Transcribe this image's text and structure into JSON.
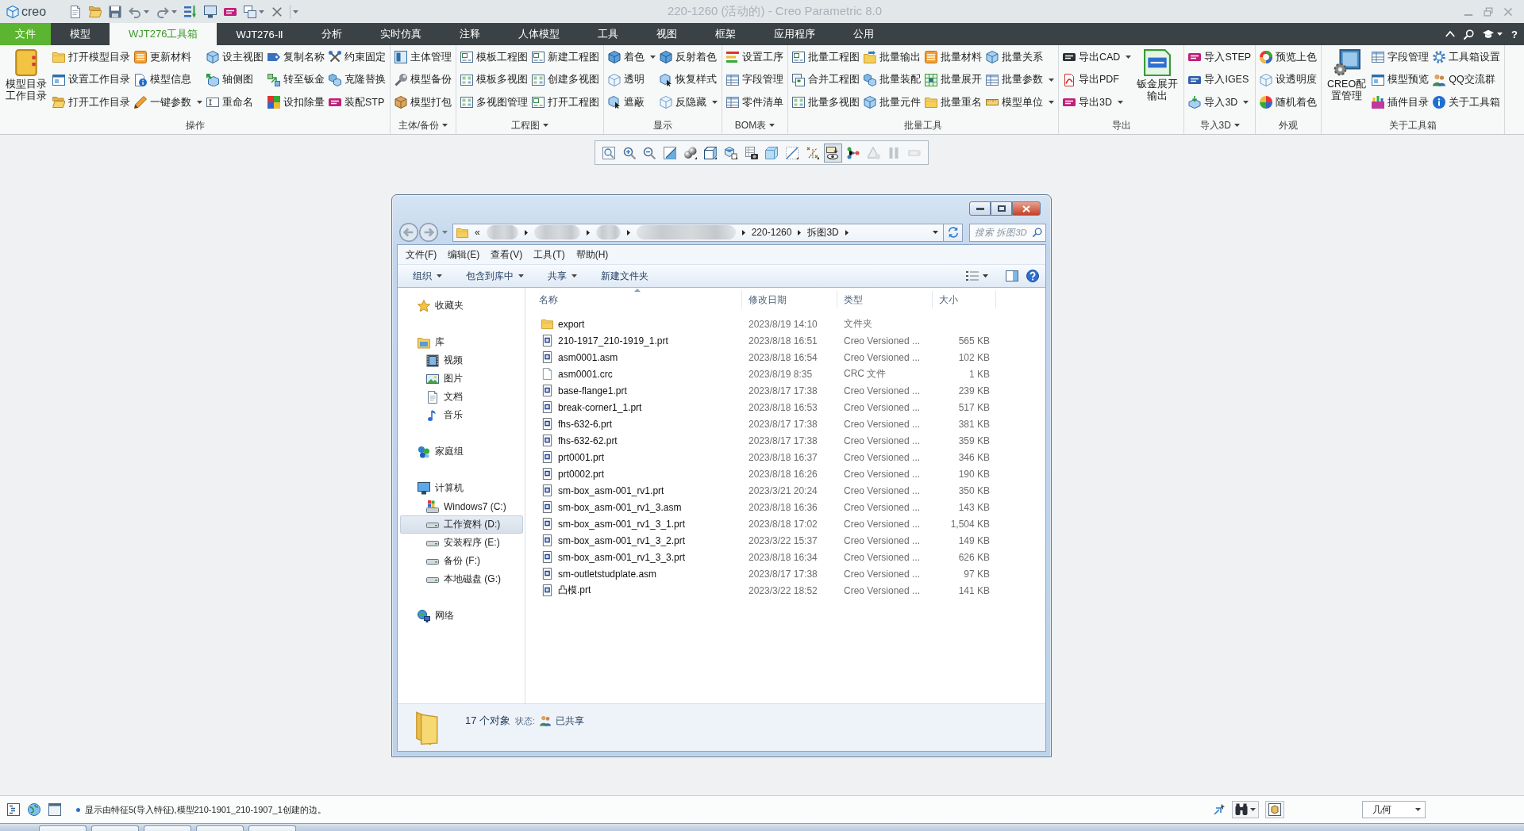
{
  "app_window": {
    "logo": "creo",
    "title": "220-1260 (活动的) - Creo Parametric 8.0"
  },
  "ribbon_tabs": [
    {
      "label": "文件",
      "kind": "file",
      "selected": false
    },
    {
      "label": "模型",
      "kind": "tab",
      "selected": false
    },
    {
      "label": "WJT276工具箱",
      "kind": "tab",
      "selected": true
    },
    {
      "label": "WJT276-Ⅱ",
      "kind": "tab",
      "selected": false
    },
    {
      "label": "分析",
      "kind": "tab",
      "selected": false
    },
    {
      "label": "实时仿真",
      "kind": "tab",
      "selected": false
    },
    {
      "label": "注释",
      "kind": "tab",
      "selected": false
    },
    {
      "label": "人体模型",
      "kind": "tab",
      "selected": false
    },
    {
      "label": "工具",
      "kind": "tab",
      "selected": false
    },
    {
      "label": "视图",
      "kind": "tab",
      "selected": false
    },
    {
      "label": "框架",
      "kind": "tab",
      "selected": false
    },
    {
      "label": "应用程序",
      "kind": "tab",
      "selected": false
    },
    {
      "label": "公用",
      "kind": "tab",
      "selected": false
    }
  ],
  "ribbon_help": "?",
  "ribbon_groups": [
    {
      "label": "操作",
      "has_menu": false,
      "blocks": [
        {
          "kind": "large",
          "lines": [
            "模型目录",
            "工作目录"
          ]
        },
        {
          "kind": "column",
          "buttons": [
            {
              "label": "打开模型目录",
              "has_menu": false
            },
            {
              "label": "设置工作目录",
              "has_menu": false
            },
            {
              "label": "打开工作目录",
              "has_menu": false
            }
          ]
        },
        {
          "kind": "column",
          "buttons": [
            {
              "label": "更新材料",
              "has_menu": false
            },
            {
              "label": "模型信息",
              "has_menu": false
            },
            {
              "label": "一键参数",
              "has_menu": true
            }
          ]
        },
        {
          "kind": "column",
          "buttons": [
            {
              "label": "设主视图",
              "has_menu": false
            },
            {
              "label": "轴侧图",
              "has_menu": false
            },
            {
              "label": "重命名",
              "has_menu": false
            }
          ]
        },
        {
          "kind": "column",
          "buttons": [
            {
              "label": "复制名称",
              "has_menu": false
            },
            {
              "label": "转至钣金",
              "has_menu": false
            },
            {
              "label": "设扣除量",
              "has_menu": false
            }
          ]
        },
        {
          "kind": "column",
          "buttons": [
            {
              "label": "约束固定",
              "has_menu": false
            },
            {
              "label": "克隆替换",
              "has_menu": false
            },
            {
              "label": "装配STP",
              "has_menu": false
            }
          ]
        }
      ]
    },
    {
      "label": "主体/备份",
      "has_menu": true,
      "blocks": [
        {
          "kind": "column",
          "buttons": [
            {
              "label": "主体管理",
              "has_menu": false
            },
            {
              "label": "模型备份",
              "has_menu": false
            },
            {
              "label": "模型打包",
              "has_menu": false
            }
          ]
        }
      ]
    },
    {
      "label": "工程图",
      "has_menu": true,
      "blocks": [
        {
          "kind": "column",
          "buttons": [
            {
              "label": "模板工程图",
              "has_menu": false
            },
            {
              "label": "模板多视图",
              "has_menu": false
            },
            {
              "label": "多视图管理",
              "has_menu": false
            }
          ]
        },
        {
          "kind": "column",
          "buttons": [
            {
              "label": "新建工程图",
              "has_menu": false
            },
            {
              "label": "创建多视图",
              "has_menu": false
            },
            {
              "label": "打开工程图",
              "has_menu": false
            }
          ]
        }
      ]
    },
    {
      "label": "显示",
      "has_menu": false,
      "blocks": [
        {
          "kind": "column",
          "buttons": [
            {
              "label": "着色",
              "has_menu": true
            },
            {
              "label": "透明",
              "has_menu": false
            },
            {
              "label": "遮蔽",
              "has_menu": false
            }
          ]
        },
        {
          "kind": "column",
          "buttons": [
            {
              "label": "反射着色",
              "has_menu": false
            },
            {
              "label": "恢复样式",
              "has_menu": false
            },
            {
              "label": "反隐藏",
              "has_menu": true
            }
          ]
        }
      ]
    },
    {
      "label": "BOM表",
      "has_menu": true,
      "blocks": [
        {
          "kind": "column",
          "buttons": [
            {
              "label": "设置工序",
              "has_menu": false
            },
            {
              "label": "字段管理",
              "has_menu": false
            },
            {
              "label": "零件清单",
              "has_menu": false
            }
          ]
        }
      ]
    },
    {
      "label": "批量工具",
      "has_menu": false,
      "blocks": [
        {
          "kind": "column",
          "buttons": [
            {
              "label": "批量工程图",
              "has_menu": false
            },
            {
              "label": "合并工程图",
              "has_menu": false
            },
            {
              "label": "批量多视图",
              "has_menu": false
            }
          ]
        },
        {
          "kind": "column",
          "buttons": [
            {
              "label": "批量输出",
              "has_menu": false
            },
            {
              "label": "批量装配",
              "has_menu": false
            },
            {
              "label": "批量元件",
              "has_menu": false
            }
          ]
        },
        {
          "kind": "column",
          "buttons": [
            {
              "label": "批量材料",
              "has_menu": false
            },
            {
              "label": "批量展开",
              "has_menu": false
            },
            {
              "label": "批量重名",
              "has_menu": false
            }
          ]
        },
        {
          "kind": "column",
          "buttons": [
            {
              "label": "批量关系",
              "has_menu": false
            },
            {
              "label": "批量参数",
              "has_menu": true
            },
            {
              "label": "模型单位",
              "has_menu": true
            }
          ]
        }
      ]
    },
    {
      "label": "导出",
      "has_menu": false,
      "blocks": [
        {
          "kind": "column",
          "buttons": [
            {
              "label": "导出CAD",
              "has_menu": true
            },
            {
              "label": "导出PDF",
              "has_menu": false
            },
            {
              "label": "导出3D",
              "has_menu": true
            }
          ]
        },
        {
          "kind": "large",
          "lines": [
            "钣金展开",
            "输出"
          ]
        }
      ]
    },
    {
      "label": "导入3D",
      "has_menu": true,
      "blocks": [
        {
          "kind": "column",
          "buttons": [
            {
              "label": "导入STEP",
              "has_menu": false
            },
            {
              "label": "导入IGES",
              "has_menu": false
            },
            {
              "label": "导入3D",
              "has_menu": true
            }
          ]
        }
      ]
    },
    {
      "label": "外观",
      "has_menu": false,
      "blocks": [
        {
          "kind": "column",
          "buttons": [
            {
              "label": "预览上色",
              "has_menu": false
            },
            {
              "label": "设透明度",
              "has_menu": false
            },
            {
              "label": "随机着色",
              "has_menu": false
            }
          ]
        }
      ]
    },
    {
      "label": "关于工具箱",
      "has_menu": false,
      "blocks": [
        {
          "kind": "large",
          "lines": [
            "CREO配",
            "置管理"
          ]
        },
        {
          "kind": "column",
          "buttons": [
            {
              "label": "字段管理",
              "has_menu": false
            },
            {
              "label": "模型预览",
              "has_menu": false
            },
            {
              "label": "插件目录",
              "has_menu": false
            }
          ]
        },
        {
          "kind": "column",
          "buttons": [
            {
              "label": "工具箱设置",
              "has_menu": false
            },
            {
              "label": "QQ交流群",
              "has_menu": false
            },
            {
              "label": "关于工具箱",
              "has_menu": false
            }
          ]
        }
      ]
    }
  ],
  "graphics_toolbar": {
    "buttons": [
      {
        "pressed": false,
        "disabled": false
      },
      {
        "pressed": false,
        "disabled": false
      },
      {
        "pressed": false,
        "disabled": false
      },
      {
        "pressed": false,
        "disabled": false
      },
      {
        "pressed": false,
        "disabled": false
      },
      {
        "pressed": false,
        "disabled": false
      },
      {
        "pressed": false,
        "disabled": false
      },
      {
        "pressed": false,
        "disabled": false
      },
      {
        "pressed": false,
        "disabled": false
      },
      {
        "pressed": false,
        "disabled": false
      },
      {
        "pressed": false,
        "disabled": false
      },
      {
        "pressed": true,
        "disabled": false
      },
      {
        "pressed": false,
        "disabled": false
      },
      {
        "pressed": false,
        "disabled": true
      },
      {
        "pressed": false,
        "disabled": true
      },
      {
        "pressed": false,
        "disabled": true
      }
    ]
  },
  "explorer": {
    "address": {
      "overflow": "«",
      "segments": [
        {
          "kind": "blurred"
        },
        {
          "kind": "blurred"
        },
        {
          "kind": "blurred"
        },
        {
          "kind": "blurred"
        },
        {
          "kind": "text",
          "label": "220-1260"
        },
        {
          "kind": "text",
          "label": "拆图3D"
        }
      ]
    },
    "search": {
      "placeholder": "搜索 拆图3D"
    },
    "menu": [
      "文件(F)",
      "编辑(E)",
      "查看(V)",
      "工具(T)",
      "帮助(H)"
    ],
    "commands": [
      {
        "label": "组织",
        "has_menu": true
      },
      {
        "label": "包含到库中",
        "has_menu": true
      },
      {
        "label": "共享",
        "has_menu": true
      },
      {
        "label": "新建文件夹",
        "has_menu": false
      }
    ],
    "nav": [
      {
        "label": "收藏夹",
        "selected": false
      },
      {
        "label": "库",
        "selected": false,
        "children": [
          {
            "label": "视频",
            "selected": false
          },
          {
            "label": "图片",
            "selected": false
          },
          {
            "label": "文档",
            "selected": false
          },
          {
            "label": "音乐",
            "selected": false
          }
        ]
      },
      {
        "label": "家庭组",
        "selected": false
      },
      {
        "label": "计算机",
        "selected": false,
        "children": [
          {
            "label": "Windows7 (C:)",
            "selected": false
          },
          {
            "label": "工作资料 (D:)",
            "selected": true
          },
          {
            "label": "安装程序 (E:)",
            "selected": false
          },
          {
            "label": "备份 (F:)",
            "selected": false
          },
          {
            "label": "本地磁盘 (G:)",
            "selected": false
          }
        ]
      },
      {
        "label": "网络",
        "selected": false
      }
    ],
    "columns": [
      {
        "label": "名称",
        "sorted": true
      },
      {
        "label": "修改日期",
        "sorted": false
      },
      {
        "label": "类型",
        "sorted": false
      },
      {
        "label": "大小",
        "sorted": false
      }
    ],
    "files": [
      {
        "name": "export",
        "kind": "folder",
        "modified": "2023/8/19 14:10",
        "type": "文件夹"
      },
      {
        "name": "210-1917_210-1919_1.prt",
        "kind": "model",
        "modified": "2023/8/18 16:51",
        "type": "Creo Versioned ...",
        "size": "565 KB"
      },
      {
        "name": "asm0001.asm",
        "kind": "model",
        "modified": "2023/8/18 16:54",
        "type": "Creo Versioned ...",
        "size": "102 KB"
      },
      {
        "name": "asm0001.crc",
        "kind": "blank",
        "modified": "2023/8/19 8:35",
        "type": "CRC 文件",
        "size": "1 KB"
      },
      {
        "name": "base-flange1.prt",
        "kind": "model",
        "modified": "2023/8/17 17:38",
        "type": "Creo Versioned ...",
        "size": "239 KB"
      },
      {
        "name": "break-corner1_1.prt",
        "kind": "model",
        "modified": "2023/8/18 16:53",
        "type": "Creo Versioned ...",
        "size": "517 KB"
      },
      {
        "name": "fhs-632-6.prt",
        "kind": "model",
        "modified": "2023/8/17 17:38",
        "type": "Creo Versioned ...",
        "size": "381 KB"
      },
      {
        "name": "fhs-632-62.prt",
        "kind": "model",
        "modified": "2023/8/17 17:38",
        "type": "Creo Versioned ...",
        "size": "359 KB"
      },
      {
        "name": "prt0001.prt",
        "kind": "model",
        "modified": "2023/8/18 16:37",
        "type": "Creo Versioned ...",
        "size": "346 KB"
      },
      {
        "name": "prt0002.prt",
        "kind": "model",
        "modified": "2023/8/18 16:26",
        "type": "Creo Versioned ...",
        "size": "190 KB"
      },
      {
        "name": "sm-box_asm-001_rv1.prt",
        "kind": "model",
        "modified": "2023/3/21 20:24",
        "type": "Creo Versioned ...",
        "size": "350 KB"
      },
      {
        "name": "sm-box_asm-001_rv1_3.asm",
        "kind": "model",
        "modified": "2023/8/18 16:36",
        "type": "Creo Versioned ...",
        "size": "143 KB"
      },
      {
        "name": "sm-box_asm-001_rv1_3_1.prt",
        "kind": "model",
        "modified": "2023/8/18 17:02",
        "type": "Creo Versioned ...",
        "size": "1,504 KB"
      },
      {
        "name": "sm-box_asm-001_rv1_3_2.prt",
        "kind": "model",
        "modified": "2023/3/22 15:37",
        "type": "Creo Versioned ...",
        "size": "149 KB"
      },
      {
        "name": "sm-box_asm-001_rv1_3_3.prt",
        "kind": "model",
        "modified": "2023/8/18 16:34",
        "type": "Creo Versioned ...",
        "size": "626 KB"
      },
      {
        "name": "sm-outletstudplate.asm",
        "kind": "model",
        "modified": "2023/8/17 17:38",
        "type": "Creo Versioned ...",
        "size": "97 KB"
      },
      {
        "name": "凸模.prt",
        "kind": "model",
        "modified": "2023/3/22 18:52",
        "type": "Creo Versioned ...",
        "size": "141 KB"
      }
    ],
    "details": {
      "count": "17 个对象",
      "state_label": "状态:",
      "state": "已共享"
    }
  },
  "status_bar": {
    "message": "显示由特征5(导入特征),模型210-1901_210-1907_1创建的边。",
    "filter": "几何"
  }
}
